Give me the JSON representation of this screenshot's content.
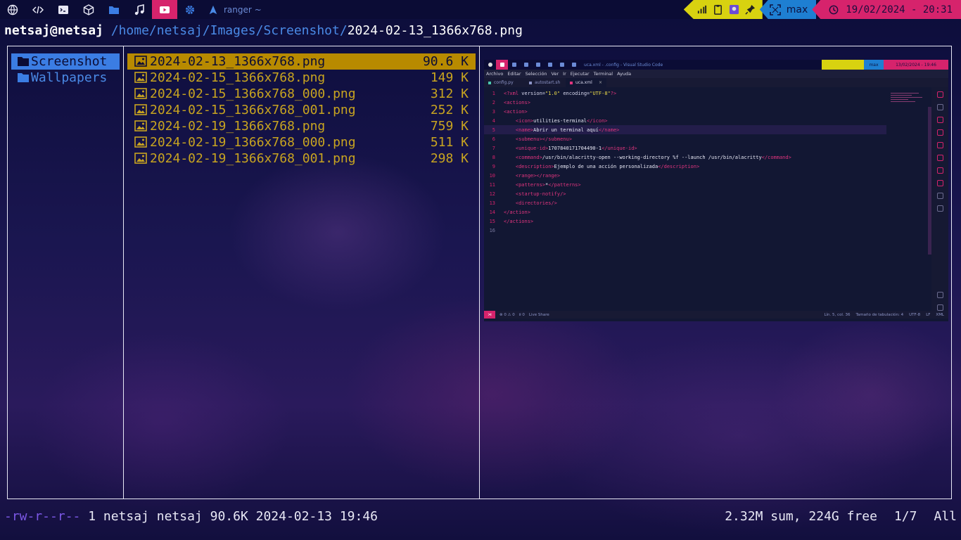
{
  "topbar": {
    "workspaces": [
      {
        "icon": "globe-icon",
        "active": false
      },
      {
        "icon": "code-icon",
        "active": false
      },
      {
        "icon": "terminal-icon",
        "active": false
      },
      {
        "icon": "cube-icon",
        "active": false
      },
      {
        "icon": "folder-icon",
        "active": false
      },
      {
        "icon": "music-icon",
        "active": false
      },
      {
        "icon": "video-icon",
        "active": true
      },
      {
        "icon": "gear-icon",
        "active": false
      }
    ],
    "window_title": "ranger ~",
    "layout_label": "max",
    "clock": "19/02/2024 - 20:31",
    "colors": {
      "tray": "#d8d210",
      "layout": "#1e7fd2",
      "clock": "#d6236c",
      "active_ws": "#d6236c"
    }
  },
  "pathbar": {
    "host": "netsaj@netsaj",
    "dir": "/home/netsaj/Images/Screenshot/",
    "file": "2024-02-13_1366x768.png"
  },
  "parent_column": {
    "items": [
      {
        "name": "Screenshot",
        "selected": true
      },
      {
        "name": "Wallpapers",
        "selected": false
      }
    ]
  },
  "file_column": {
    "items": [
      {
        "name": "2024-02-13_1366x768.png",
        "size": "90.6 K",
        "selected": true
      },
      {
        "name": "2024-02-15_1366x768.png",
        "size": "149 K",
        "selected": false
      },
      {
        "name": "2024-02-15_1366x768_000.png",
        "size": "312 K",
        "selected": false
      },
      {
        "name": "2024-02-15_1366x768_001.png",
        "size": "252 K",
        "selected": false
      },
      {
        "name": "2024-02-19_1366x768.png",
        "size": "759 K",
        "selected": false
      },
      {
        "name": "2024-02-19_1366x768_000.png",
        "size": "511 K",
        "selected": false
      },
      {
        "name": "2024-02-19_1366x768_001.png",
        "size": "298 K",
        "selected": false
      }
    ]
  },
  "preview": {
    "window_title": "uca.xml - .config - Visual Studio Code",
    "layout_label": "max",
    "clock": "13/02/2024 - 19:46",
    "menu": [
      "Archivo",
      "Editar",
      "Selección",
      "Ver",
      "Ir",
      "Ejecutar",
      "Terminal",
      "Ayuda"
    ],
    "tabs": [
      {
        "label": "config.py",
        "active": false
      },
      {
        "label": "autostart.sh",
        "active": false
      },
      {
        "label": "uca.xml",
        "active": true
      }
    ],
    "code_lines": [
      {
        "n": "1",
        "html": "<span class='tag'>&lt;?xml</span> <span class='attr'>version=</span><span class='str'>\"1.0\"</span> <span class='attr'>encoding=</span><span class='str'>\"UTF-8\"</span><span class='tag'>?&gt;</span>"
      },
      {
        "n": "2",
        "html": "<span class='tag'>&lt;actions&gt;</span>"
      },
      {
        "n": "3",
        "html": "<span class='tag'>&lt;action&gt;</span>"
      },
      {
        "n": "4",
        "html": "    <span class='tag'>&lt;icon&gt;</span><span class='txt'>utilities-terminal</span><span class='tag'>&lt;/icon&gt;</span>"
      },
      {
        "n": "5",
        "html": "    <span class='tag'>&lt;name&gt;</span><span class='txt'>Abrir un terminal aquí</span><span class='tag'>&lt;/name&gt;</span>",
        "current": true
      },
      {
        "n": "6",
        "html": "    <span class='tag'>&lt;submenu&gt;&lt;/submenu&gt;</span>"
      },
      {
        "n": "7",
        "html": "    <span class='tag'>&lt;unique-id&gt;</span><span class='txt'>1707840171704490-1</span><span class='tag'>&lt;/unique-id&gt;</span>"
      },
      {
        "n": "8",
        "html": "    <span class='tag'>&lt;command&gt;</span><span class='txt'>/usr/bin/alacritty-open --working-directory %f --launch /usr/bin/alacritty</span><span class='tag'>&lt;/command&gt;</span>"
      },
      {
        "n": "9",
        "html": "    <span class='tag'>&lt;description&gt;</span><span class='txt'>Ejemplo de una acción personalizada</span><span class='tag'>&lt;/description&gt;</span>"
      },
      {
        "n": "10",
        "html": "    <span class='tag'>&lt;range&gt;&lt;/range&gt;</span>"
      },
      {
        "n": "11",
        "html": "    <span class='tag'>&lt;patterns&gt;</span><span class='txt'>*</span><span class='tag'>&lt;/patterns&gt;</span>"
      },
      {
        "n": "12",
        "html": "    <span class='tag'>&lt;startup-notify/&gt;</span>"
      },
      {
        "n": "13",
        "html": "    <span class='tag'>&lt;directories/&gt;</span>"
      },
      {
        "n": "14",
        "html": "<span class='tag'>&lt;/action&gt;</span>"
      },
      {
        "n": "15",
        "html": "<span class='tag'>&lt;/actions&gt;</span>"
      },
      {
        "n": "16",
        "html": "",
        "dim": true
      }
    ],
    "status_left": [
      "⊗ 0 ⚠ 0",
      "ʬ 0",
      "Live Share"
    ],
    "status_right": [
      "Lín. 5, col. 36",
      "Tamaño de tabulación: 4",
      "UTF-8",
      "LF",
      "XML"
    ]
  },
  "status": {
    "permissions": "-rw-r--r--",
    "meta": " 1 netsaj netsaj 90.6K 2024-02-13 19:46",
    "disk": "2.32M sum, 224G free",
    "position": "1/7",
    "scroll": "All"
  }
}
